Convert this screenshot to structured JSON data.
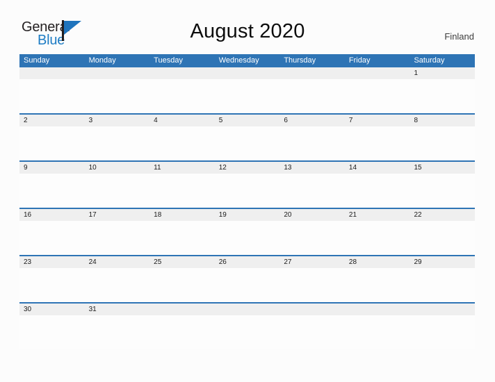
{
  "brand": {
    "name_part1": "General",
    "name_part2": "Blue",
    "flag_icon": "flag-icon"
  },
  "header": {
    "title": "August 2020",
    "region": "Finland"
  },
  "theme": {
    "header_blue": "#2e74b5",
    "band_gray": "#efefef",
    "page_background": "#fcfcfc",
    "brand_blue": "#1d7cc4",
    "brand_dark": "#231f20"
  },
  "calendar": {
    "month": "August",
    "year": "2020",
    "weekday_headers": [
      "Sunday",
      "Monday",
      "Tuesday",
      "Wednesday",
      "Thursday",
      "Friday",
      "Saturday"
    ],
    "weeks": [
      [
        "",
        "",
        "",
        "",
        "",
        "",
        "1"
      ],
      [
        "2",
        "3",
        "4",
        "5",
        "6",
        "7",
        "8"
      ],
      [
        "9",
        "10",
        "11",
        "12",
        "13",
        "14",
        "15"
      ],
      [
        "16",
        "17",
        "18",
        "19",
        "20",
        "21",
        "22"
      ],
      [
        "23",
        "24",
        "25",
        "26",
        "27",
        "28",
        "29"
      ],
      [
        "30",
        "31",
        "",
        "",
        "",
        "",
        ""
      ]
    ]
  }
}
